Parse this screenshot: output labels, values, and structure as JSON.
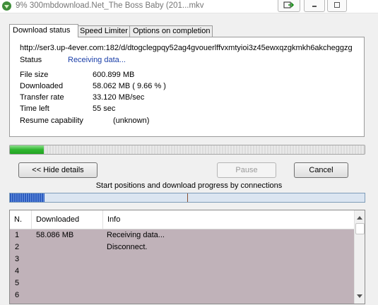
{
  "window": {
    "title": "9% 300mbdownload.Net_The Boss Baby (201...mkv"
  },
  "tabs": [
    {
      "label": "Download status",
      "active": true
    },
    {
      "label": "Speed Limiter",
      "active": false
    },
    {
      "label": "Options on completion",
      "active": false
    }
  ],
  "status": {
    "url": "http://ser3.up-4ever.com:182/d/dtogclegpqy52ag4gvouerlffvxmtyioi3z45ewxqzgkmkh6akcheggzg",
    "status_label": "Status",
    "status_value": "Receiving data...",
    "file_size_label": "File size",
    "file_size_value": "600.899  MB",
    "downloaded_label": "Downloaded",
    "downloaded_value": "58.062  MB  ( 9.66 % )",
    "transfer_rate_label": "Transfer rate",
    "transfer_rate_value": "33.120  MB/sec",
    "time_left_label": "Time left",
    "time_left_value": "55 sec",
    "resume_label": "Resume capability",
    "resume_value": "(unknown)"
  },
  "progress": {
    "fraction": 0.0966,
    "fill_color": "#2fb52f"
  },
  "buttons": {
    "hide_details": "<< Hide details",
    "pause": "Pause",
    "cancel": "Cancel"
  },
  "connections": {
    "caption": "Start positions and download progress by connections",
    "fill_fraction": 0.097,
    "marker_fraction": 0.5
  },
  "table": {
    "columns": [
      "N.",
      "Downloaded",
      "Info"
    ],
    "rows": [
      {
        "n": "1",
        "downloaded": "58.086  MB",
        "info": "Receiving data..."
      },
      {
        "n": "2",
        "downloaded": "",
        "info": "Disconnect."
      },
      {
        "n": "3",
        "downloaded": "",
        "info": ""
      },
      {
        "n": "4",
        "downloaded": "",
        "info": ""
      },
      {
        "n": "5",
        "downloaded": "",
        "info": ""
      },
      {
        "n": "6",
        "downloaded": "",
        "info": ""
      }
    ]
  },
  "icons": {
    "app": "download-manager-icon",
    "to_tray": "arrow-right-icon",
    "minimize": "minimize-icon",
    "maximize": "maximize-icon",
    "scroll_up": "chevron-up-icon",
    "scroll_down": "chevron-down-icon"
  }
}
